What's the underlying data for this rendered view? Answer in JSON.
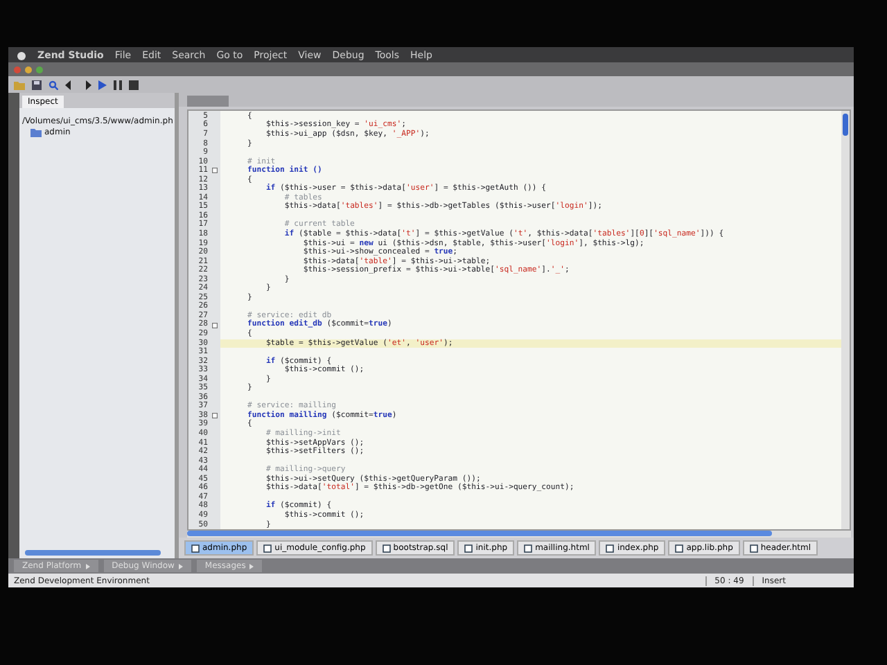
{
  "menu_bar": {
    "items": [
      "Zend Studio",
      "File",
      "Edit",
      "Search",
      "Go to",
      "Project",
      "View",
      "Debug",
      "Tools",
      "Help"
    ]
  },
  "left_panel": {
    "tabs": [
      {
        "label": "Inspect",
        "selected": true
      }
    ],
    "tree": {
      "path": "/Volumes/ui_cms/3.5/www/admin.ph",
      "children": [
        {
          "label": "admin"
        }
      ]
    }
  },
  "editor": {
    "lines": [
      {
        "number": "5",
        "fold": false,
        "current": false,
        "tokens": [
          {
            "kind": "txt",
            "text": "    {"
          }
        ]
      },
      {
        "number": "6",
        "fold": false,
        "current": false,
        "tokens": [
          {
            "kind": "txt",
            "text": "        $this->session_key = "
          },
          {
            "kind": "str",
            "text": "'ui_cms'"
          },
          {
            "kind": "txt",
            "text": ";"
          }
        ]
      },
      {
        "number": "7",
        "fold": false,
        "current": false,
        "tokens": [
          {
            "kind": "txt",
            "text": "        $this->ui_app ($dsn, $key, "
          },
          {
            "kind": "str",
            "text": "'_APP'"
          },
          {
            "kind": "txt",
            "text": ");"
          }
        ]
      },
      {
        "number": "8",
        "fold": false,
        "current": false,
        "tokens": [
          {
            "kind": "txt",
            "text": "    }"
          }
        ]
      },
      {
        "number": "9",
        "fold": false,
        "current": false
      },
      {
        "number": "10",
        "fold": false,
        "current": false,
        "tokens": [
          {
            "kind": "com",
            "text": "    # init"
          }
        ]
      },
      {
        "number": "11",
        "fold": true,
        "current": false,
        "tokens": [
          {
            "kind": "kw",
            "text": "    function init ()"
          }
        ]
      },
      {
        "number": "12",
        "fold": false,
        "current": false,
        "tokens": [
          {
            "kind": "txt",
            "text": "    {"
          }
        ]
      },
      {
        "number": "13",
        "fold": false,
        "current": false,
        "tokens": [
          {
            "kind": "kw",
            "text": "        if"
          },
          {
            "kind": "txt",
            "text": " ($this->user = $this->data["
          },
          {
            "kind": "str",
            "text": "'user'"
          },
          {
            "kind": "txt",
            "text": "] = $this->getAuth ()) {"
          }
        ]
      },
      {
        "number": "14",
        "fold": false,
        "current": false,
        "tokens": [
          {
            "kind": "com",
            "text": "            # tables"
          }
        ]
      },
      {
        "number": "15",
        "fold": false,
        "current": false,
        "tokens": [
          {
            "kind": "txt",
            "text": "            $this->data["
          },
          {
            "kind": "str",
            "text": "'tables'"
          },
          {
            "kind": "txt",
            "text": "] = $this->db->getTables ($this->user["
          },
          {
            "kind": "str",
            "text": "'login'"
          },
          {
            "kind": "txt",
            "text": "]);"
          }
        ]
      },
      {
        "number": "16",
        "fold": false,
        "current": false
      },
      {
        "number": "17",
        "fold": false,
        "current": false,
        "tokens": [
          {
            "kind": "com",
            "text": "            # current table"
          }
        ]
      },
      {
        "number": "18",
        "fold": false,
        "current": false,
        "tokens": [
          {
            "kind": "kw",
            "text": "            if"
          },
          {
            "kind": "txt",
            "text": " ($table = $this->data["
          },
          {
            "kind": "str",
            "text": "'t'"
          },
          {
            "kind": "txt",
            "text": "] = $this->getValue ("
          },
          {
            "kind": "str",
            "text": "'t'"
          },
          {
            "kind": "txt",
            "text": ", $this->data["
          },
          {
            "kind": "str",
            "text": "'tables'"
          },
          {
            "kind": "txt",
            "text": "]["
          },
          {
            "kind": "str",
            "text": "0"
          },
          {
            "kind": "txt",
            "text": "]["
          },
          {
            "kind": "str",
            "text": "'sql_name'"
          },
          {
            "kind": "txt",
            "text": "])) {"
          }
        ]
      },
      {
        "number": "19",
        "fold": false,
        "current": false,
        "tokens": [
          {
            "kind": "txt",
            "text": "                $this->ui = "
          },
          {
            "kind": "kw",
            "text": "new"
          },
          {
            "kind": "txt",
            "text": " ui ($this->dsn, $table, $this->user["
          },
          {
            "kind": "str",
            "text": "'login'"
          },
          {
            "kind": "txt",
            "text": "], $this->lg);"
          }
        ]
      },
      {
        "number": "20",
        "fold": false,
        "current": false,
        "tokens": [
          {
            "kind": "txt",
            "text": "                $this->ui->show_concealed = "
          },
          {
            "kind": "kw",
            "text": "true"
          },
          {
            "kind": "txt",
            "text": ";"
          }
        ]
      },
      {
        "number": "21",
        "fold": false,
        "current": false,
        "tokens": [
          {
            "kind": "txt",
            "text": "                $this->data["
          },
          {
            "kind": "str",
            "text": "'table'"
          },
          {
            "kind": "txt",
            "text": "] = $this->ui->table;"
          }
        ]
      },
      {
        "number": "22",
        "fold": false,
        "current": false,
        "tokens": [
          {
            "kind": "txt",
            "text": "                $this->session_prefix = $this->ui->table["
          },
          {
            "kind": "str",
            "text": "'sql_name'"
          },
          {
            "kind": "txt",
            "text": "]."
          },
          {
            "kind": "str",
            "text": "'_'"
          },
          {
            "kind": "txt",
            "text": ";"
          }
        ]
      },
      {
        "number": "23",
        "fold": false,
        "current": false,
        "tokens": [
          {
            "kind": "txt",
            "text": "            }"
          }
        ]
      },
      {
        "number": "24",
        "fold": false,
        "current": false,
        "tokens": [
          {
            "kind": "txt",
            "text": "        }"
          }
        ]
      },
      {
        "number": "25",
        "fold": false,
        "current": false,
        "tokens": [
          {
            "kind": "txt",
            "text": "    }"
          }
        ]
      },
      {
        "number": "26",
        "fold": false,
        "current": false
      },
      {
        "number": "27",
        "fold": false,
        "current": false,
        "tokens": [
          {
            "kind": "com",
            "text": "    # service: edit db"
          }
        ]
      },
      {
        "number": "28",
        "fold": true,
        "current": false,
        "tokens": [
          {
            "kind": "kw",
            "text": "    function edit_db"
          },
          {
            "kind": "txt",
            "text": " ($commit="
          },
          {
            "kind": "kw",
            "text": "true"
          },
          {
            "kind": "txt",
            "text": ")"
          }
        ]
      },
      {
        "number": "29",
        "fold": false,
        "current": false,
        "tokens": [
          {
            "kind": "txt",
            "text": "    {"
          }
        ]
      },
      {
        "number": "30",
        "fold": false,
        "current": true,
        "tokens": [
          {
            "kind": "txt",
            "text": "        $table = $this->getValue ("
          },
          {
            "kind": "str",
            "text": "'et'"
          },
          {
            "kind": "txt",
            "text": ", "
          },
          {
            "kind": "str",
            "text": "'user'"
          },
          {
            "kind": "txt",
            "text": ");"
          }
        ]
      },
      {
        "number": "31",
        "fold": false,
        "current": false
      },
      {
        "number": "32",
        "fold": false,
        "current": false,
        "tokens": [
          {
            "kind": "kw",
            "text": "        if"
          },
          {
            "kind": "txt",
            "text": " ($commit) {"
          }
        ]
      },
      {
        "number": "33",
        "fold": false,
        "current": false,
        "tokens": [
          {
            "kind": "txt",
            "text": "            $this->commit ();"
          }
        ]
      },
      {
        "number": "34",
        "fold": false,
        "current": false,
        "tokens": [
          {
            "kind": "txt",
            "text": "        }"
          }
        ]
      },
      {
        "number": "35",
        "fold": false,
        "current": false,
        "tokens": [
          {
            "kind": "txt",
            "text": "    }"
          }
        ]
      },
      {
        "number": "36",
        "fold": false,
        "current": false
      },
      {
        "number": "37",
        "fold": false,
        "current": false,
        "tokens": [
          {
            "kind": "com",
            "text": "    # service: mailling"
          }
        ]
      },
      {
        "number": "38",
        "fold": true,
        "current": false,
        "tokens": [
          {
            "kind": "kw",
            "text": "    function mailling"
          },
          {
            "kind": "txt",
            "text": " ($commit="
          },
          {
            "kind": "kw",
            "text": "true"
          },
          {
            "kind": "txt",
            "text": ")"
          }
        ]
      },
      {
        "number": "39",
        "fold": false,
        "current": false,
        "tokens": [
          {
            "kind": "txt",
            "text": "    {"
          }
        ]
      },
      {
        "number": "40",
        "fold": false,
        "current": false,
        "tokens": [
          {
            "kind": "com",
            "text": "        # mailling->init"
          }
        ]
      },
      {
        "number": "41",
        "fold": false,
        "current": false,
        "tokens": [
          {
            "kind": "txt",
            "text": "        $this->setAppVars ();"
          }
        ]
      },
      {
        "number": "42",
        "fold": false,
        "current": false,
        "tokens": [
          {
            "kind": "txt",
            "text": "        $this->setFilters ();"
          }
        ]
      },
      {
        "number": "43",
        "fold": false,
        "current": false
      },
      {
        "number": "44",
        "fold": false,
        "current": false,
        "tokens": [
          {
            "kind": "com",
            "text": "        # mailling->query"
          }
        ]
      },
      {
        "number": "45",
        "fold": false,
        "current": false,
        "tokens": [
          {
            "kind": "txt",
            "text": "        $this->ui->setQuery ($this->getQueryParam ());"
          }
        ]
      },
      {
        "number": "46",
        "fold": false,
        "current": false,
        "tokens": [
          {
            "kind": "txt",
            "text": "        $this->data["
          },
          {
            "kind": "str",
            "text": "'total'"
          },
          {
            "kind": "txt",
            "text": "] = $this->db->getOne ($this->ui->query_count);"
          }
        ]
      },
      {
        "number": "47",
        "fold": false,
        "current": false
      },
      {
        "number": "48",
        "fold": false,
        "current": false,
        "tokens": [
          {
            "kind": "kw",
            "text": "        if"
          },
          {
            "kind": "txt",
            "text": " ($commit) {"
          }
        ]
      },
      {
        "number": "49",
        "fold": false,
        "current": false,
        "tokens": [
          {
            "kind": "txt",
            "text": "            $this->commit ();"
          }
        ]
      },
      {
        "number": "50",
        "fold": false,
        "current": false,
        "tokens": [
          {
            "kind": "txt",
            "text": "        }"
          }
        ]
      }
    ],
    "file_tabs": [
      {
        "label": "admin.php",
        "selected": true
      },
      {
        "label": "ui_module_config.php",
        "selected": false
      },
      {
        "label": "bootstrap.sql",
        "selected": false
      },
      {
        "label": "init.php",
        "selected": false
      },
      {
        "label": "mailling.html",
        "selected": false
      },
      {
        "label": "index.php",
        "selected": false
      },
      {
        "label": "app.lib.php",
        "selected": false
      },
      {
        "label": "header.html",
        "selected": false
      }
    ]
  },
  "view_tabs": [
    "Zend Platform",
    "Debug Window",
    "Messages"
  ],
  "status_bar": {
    "text": "Zend Development Environment",
    "position": "50 : 49",
    "mode": "Insert"
  }
}
